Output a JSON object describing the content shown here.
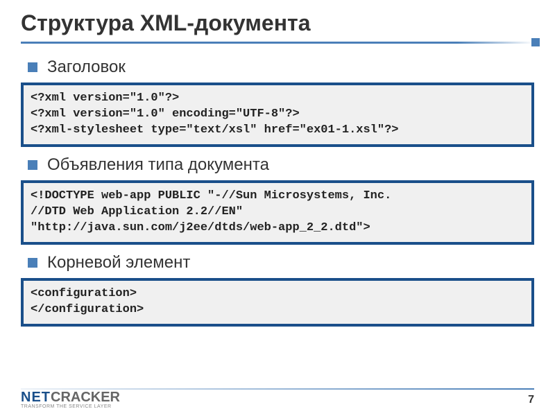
{
  "title": "Структура XML-документа",
  "sections": [
    {
      "label": "Заголовок",
      "code": "<?xml version=\"1.0\"?>\n<?xml version=\"1.0\" encoding=\"UTF-8\"?>\n<?xml-stylesheet type=\"text/xsl\" href=\"ex01-1.xsl\"?>"
    },
    {
      "label": "Объявления типа документа",
      "code": "<!DOCTYPE web-app PUBLIC \"-//Sun Microsystems, Inc.\n//DTD Web Application 2.2//EN\"\n\"http://java.sun.com/j2ee/dtds/web-app_2_2.dtd\">"
    },
    {
      "label": "Корневой элемент",
      "code": "<configuration>\n</configuration>"
    }
  ],
  "logo": {
    "part1": "NET",
    "part2": "CRACKER",
    "tagline": "TRANSFORM THE SERVICE LAYER"
  },
  "page_number": "7"
}
